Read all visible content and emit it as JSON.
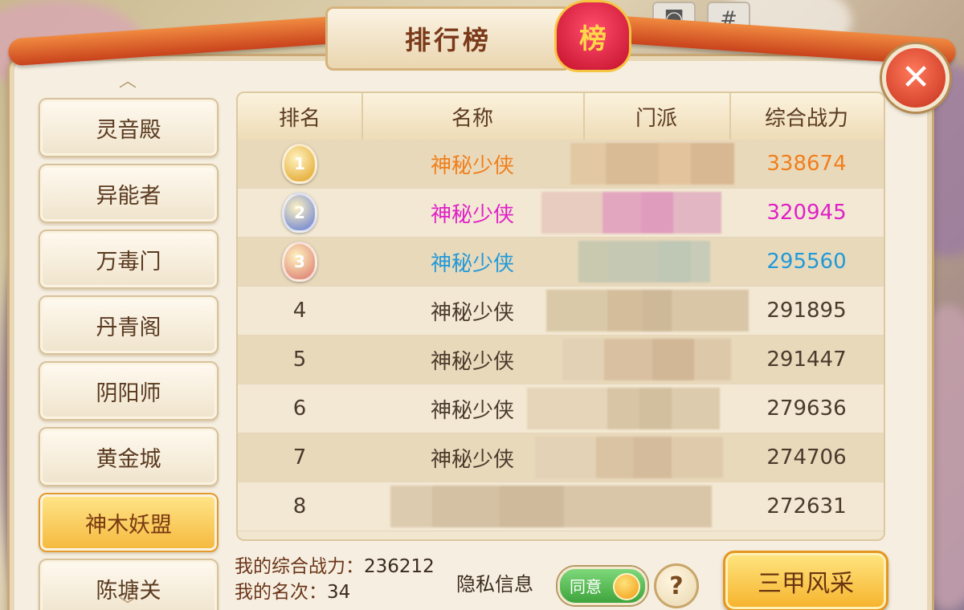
{
  "header": {
    "title": "排行榜",
    "badge_text": "榜",
    "close_glyph": "✕"
  },
  "sidebar": {
    "items": [
      {
        "label": "灵音殿",
        "active": false
      },
      {
        "label": "异能者",
        "active": false
      },
      {
        "label": "万毒门",
        "active": false
      },
      {
        "label": "丹青阁",
        "active": false
      },
      {
        "label": "阴阳师",
        "active": false
      },
      {
        "label": "黄金城",
        "active": false
      },
      {
        "label": "神木妖盟",
        "active": true
      },
      {
        "label": "陈塘关",
        "active": false
      }
    ]
  },
  "table": {
    "columns": [
      "排名",
      "名称",
      "门派",
      "综合战力"
    ],
    "rows": [
      {
        "rank": "1",
        "name": "神秘少侠",
        "power": "338674",
        "color": "#f07f1c",
        "medal": true,
        "medal_color": "#e0a020",
        "blur": [
          "#e2c9a4",
          "#d9bc96",
          "#e3c39b",
          "#d8b893"
        ]
      },
      {
        "rank": "2",
        "name": "神秘少侠",
        "power": "320945",
        "color": "#e020c8",
        "medal": true,
        "medal_color": "#5f78d6",
        "blur": [
          "#e8ccc0",
          "#e2a7bf",
          "#e09cbc",
          "#e2b6c2"
        ]
      },
      {
        "rank": "3",
        "name": "神秘少侠",
        "power": "295560",
        "color": "#2199d8",
        "medal": true,
        "medal_color": "#d9746a",
        "blur": [
          "#c9c9b0",
          "#c5c8b3",
          "#bfc7b5",
          "#c8cbb7"
        ]
      },
      {
        "rank": "4",
        "name": "神秘少侠",
        "power": "291895",
        "color": "#4a3a2c",
        "medal": false,
        "medal_color": "",
        "blur": [
          "#dac9a8",
          "#d3bd9b",
          "#cdb898",
          "#d8c6a6"
        ]
      },
      {
        "rank": "5",
        "name": "神秘少侠",
        "power": "291447",
        "color": "#4a3a2c",
        "medal": false,
        "medal_color": "",
        "blur": [
          "#e2d1b4",
          "#d9c0a1",
          "#d2b797",
          "#ddc8aa"
        ]
      },
      {
        "rank": "6",
        "name": "神秘少侠",
        "power": "279636",
        "color": "#4a3a2c",
        "medal": false,
        "medal_color": "",
        "blur": [
          "#e6d5b9",
          "#d8c5a5",
          "#d2bf9e",
          "#dccbac"
        ]
      },
      {
        "rank": "7",
        "name": "神秘少侠",
        "power": "274706",
        "color": "#4a3a2c",
        "medal": false,
        "medal_color": "",
        "blur": [
          "#e3d2b5",
          "#d9c3a3",
          "#d4bb9b",
          "#dfcbac"
        ]
      },
      {
        "rank": "8",
        "name": "",
        "power": "272631",
        "color": "#4a3a2c",
        "medal": false,
        "medal_color": "",
        "blur": [
          "#ddcbb0",
          "#d4c0a3",
          "#cfba9c",
          "#d9c5a8"
        ]
      }
    ]
  },
  "footer": {
    "power_label": "我的综合战力：",
    "power_value": "236212",
    "rank_label": "我的名次：",
    "rank_value": "34",
    "privacy_label": "隐私信息",
    "agree_label": "同意",
    "agree_on": true,
    "help_glyph": "?",
    "sanjia_label": "三甲风采"
  },
  "colors": {
    "accent_orange": "#f07f1c",
    "accent_magenta": "#e020c8",
    "accent_blue": "#2199d8",
    "active_tab": "#f5b83c"
  }
}
